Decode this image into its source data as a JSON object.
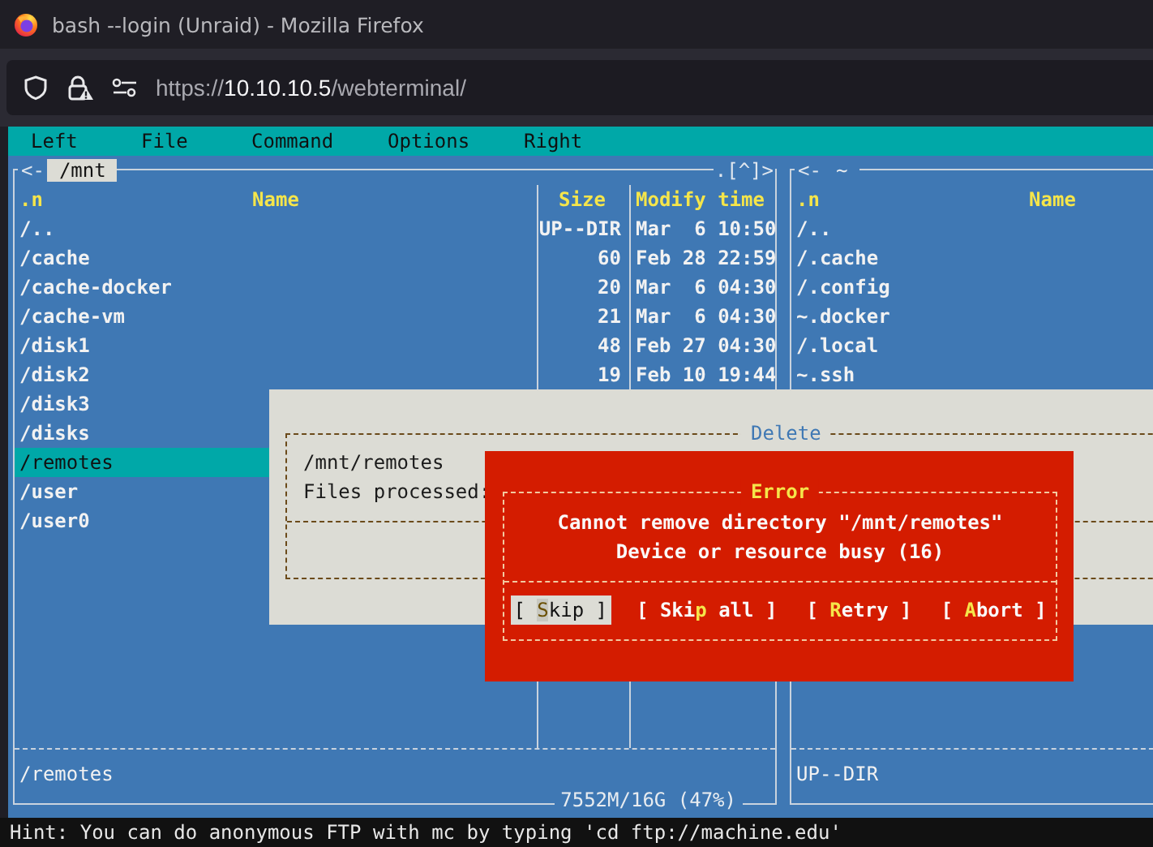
{
  "window": {
    "title": "bash --login (Unraid) - Mozilla Firefox"
  },
  "address_bar": {
    "scheme": "https://",
    "host": "10.10.10.5",
    "path": "/webterminal/"
  },
  "menu": [
    "Left",
    "File",
    "Command",
    "Options",
    "Right"
  ],
  "left_panel": {
    "arrow": "<-",
    "path": "/mnt",
    "corner": ".[^]>",
    "columns": [
      ".n",
      "Name",
      "Size",
      "Modify time"
    ],
    "rows": [
      {
        "name": "/..",
        "size": "UP--DIR",
        "time": "Mar  6 10:50",
        "selected": false
      },
      {
        "name": "/cache",
        "size": "60",
        "time": "Feb 28 22:59",
        "selected": false
      },
      {
        "name": "/cache-docker",
        "size": "20",
        "time": "Mar  6 04:30",
        "selected": false
      },
      {
        "name": "/cache-vm",
        "size": "21",
        "time": "Mar  6 04:30",
        "selected": false
      },
      {
        "name": "/disk1",
        "size": "48",
        "time": "Feb 27 04:30",
        "selected": false
      },
      {
        "name": "/disk2",
        "size": "19",
        "time": "Feb 10 19:44",
        "selected": false
      },
      {
        "name": "/disk3",
        "selected": false
      },
      {
        "name": "/disks",
        "selected": false
      },
      {
        "name": "/remotes",
        "selected": true
      },
      {
        "name": "/user",
        "selected": false
      },
      {
        "name": "/user0",
        "selected": false
      }
    ],
    "status": "/remotes",
    "disk_usage": "7552M/16G (47%)"
  },
  "right_panel": {
    "arrow": "<-",
    "path": "~",
    "columns": [
      ".n",
      "Name"
    ],
    "rows": [
      {
        "name": "/..",
        "selected": false
      },
      {
        "name": "/.cache",
        "selected": false
      },
      {
        "name": "/.config",
        "selected": false
      },
      {
        "name": "~.docker",
        "selected": false
      },
      {
        "name": "/.local",
        "selected": false
      },
      {
        "name": "~.ssh",
        "selected": false
      }
    ],
    "status": "UP--DIR"
  },
  "delete_dialog": {
    "title": "Delete",
    "lines": [
      "/mnt/remotes",
      "Files processed:"
    ]
  },
  "error_dialog": {
    "title": "Error",
    "message": [
      "Cannot remove directory \"/mnt/remotes\"",
      "Device or resource busy (16)"
    ],
    "buttons": [
      {
        "pre": "[ ",
        "hotkey": "S",
        "post": "kip ]",
        "selected": true
      },
      {
        "pre": "[ Ski",
        "hotkey": "p",
        "post": " all ]",
        "selected": false
      },
      {
        "pre": "[ ",
        "hotkey": "R",
        "post": "etry ]",
        "selected": false
      },
      {
        "pre": "[ ",
        "hotkey": "A",
        "post": "bort ]",
        "selected": false
      }
    ]
  },
  "hint": "Hint: You can do anonymous FTP with mc by typing 'cd ftp://machine.edu'"
}
